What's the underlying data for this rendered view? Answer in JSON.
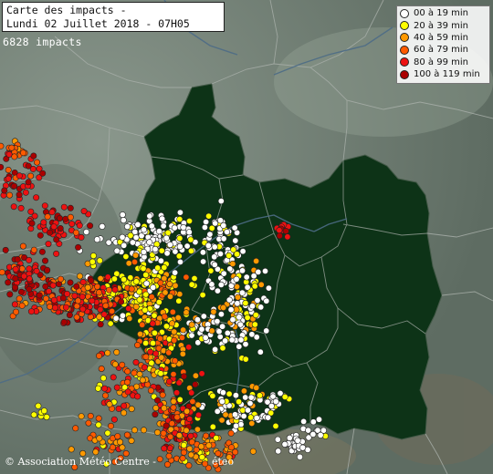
{
  "header": {
    "title_line1": "Carte des impacts -",
    "title_line2": "Lundi 02 Juillet 2018 - 07H05"
  },
  "impacts_label": "6828 impacts",
  "legend": {
    "items": [
      {
        "label": "00 à 19 min",
        "color": "#ffffff"
      },
      {
        "label": "20 à 39 min",
        "color": "#ffff00"
      },
      {
        "label": "40 à 59 min",
        "color": "#ff9900"
      },
      {
        "label": "60 à 79 min",
        "color": "#ff5a00"
      },
      {
        "label": "80 à 99 min",
        "color": "#ee1111"
      },
      {
        "label": "100 à 119 min",
        "color": "#aa0000"
      }
    ]
  },
  "credit": {
    "left": "© Association Météo Centre -",
    "right": "éteo"
  },
  "colors": {
    "land": "#6e7d74",
    "region": "#0d3317",
    "border": "#9a9a9a"
  }
}
